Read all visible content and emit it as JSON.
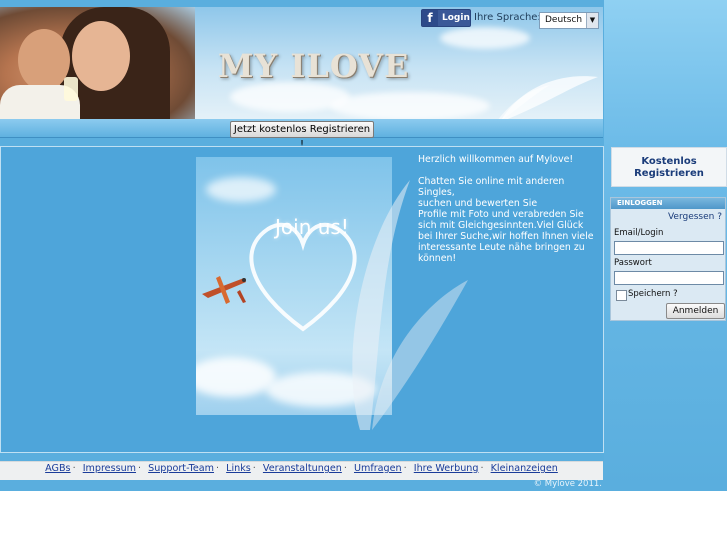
{
  "header": {
    "logo_text": "MY ILOVE",
    "fb_login_label": "Login",
    "language_label": "Ihre Sprache:",
    "language_selected": "Deutsch",
    "register_button": "Jetzt kostenlos Registrieren !"
  },
  "promo": {
    "join_text": "Join us!"
  },
  "welcome": {
    "title": "Herzlich willkommen auf Mylove!",
    "body_lines": [
      "Chatten Sie online mit anderen Singles,",
      "suchen und bewerten Sie",
      "Profile mit Foto und verabreden Sie sich mit Gleichgesinnten.Viel Glück bei Ihrer Suche,wir hoffen Ihnen viele interessante Leute nähe bringen zu können!"
    ]
  },
  "sidebar": {
    "kostenlos_line1": "Kostenlos",
    "kostenlos_line2": "Registrieren",
    "login_header": "EINLOGGEN",
    "forgot_label": "Vergessen ?",
    "email_label": "Email/Login",
    "password_label": "Passwort",
    "remember_label": "Speichern ?",
    "submit_label": "Anmelden"
  },
  "footer": {
    "links": [
      "AGBs",
      "Impressum",
      "Support-Team",
      "Links",
      "Veranstaltungen",
      "Umfragen",
      "Ihre Werbung",
      "Kleinanzeigen"
    ],
    "copyright": "© Mylove 2011."
  },
  "colors": {
    "page_blue": "#5aaede",
    "facebook_blue": "#3b5998",
    "link_blue": "#1a3c9a"
  }
}
